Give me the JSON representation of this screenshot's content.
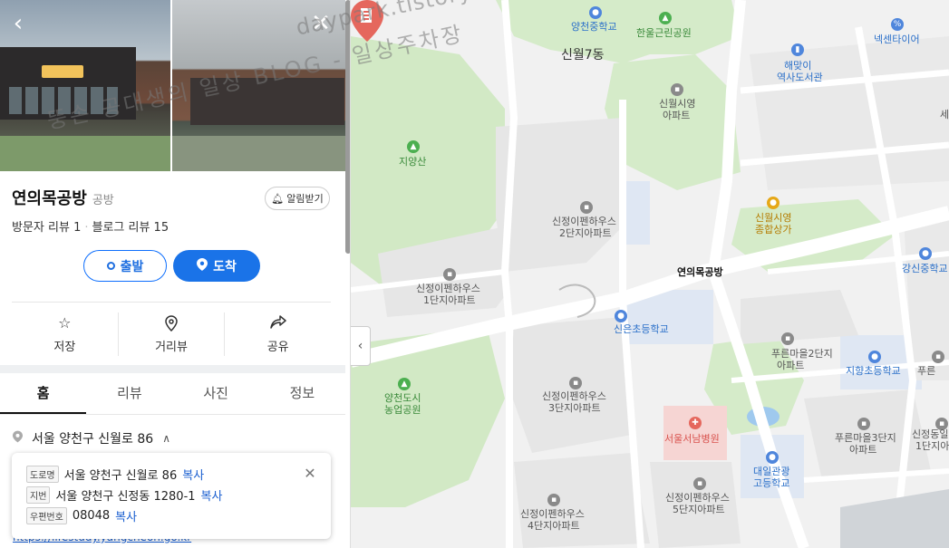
{
  "watermark": {
    "line1": "daypark.tistory.com",
    "line2": "뚱손 공대생의 일상 BLOG - 일상주차장"
  },
  "place": {
    "name": "연의목공방",
    "category": "공방",
    "alarm_label": "알림받기",
    "visitor_reviews": "방문자 리뷰 1",
    "blog_reviews": "블로그 리뷰 15"
  },
  "route": {
    "start_label": "출발",
    "end_label": "도착"
  },
  "actions": [
    {
      "label": "저장",
      "icon": "star-icon"
    },
    {
      "label": "거리뷰",
      "icon": "streetview-icon"
    },
    {
      "label": "공유",
      "icon": "share-icon"
    }
  ],
  "tabs": [
    "홈",
    "리뷰",
    "사진",
    "정보"
  ],
  "address": {
    "summary": "서울 양천구 신월로 86",
    "url": "https://lifestudy.yangcheon.go.kr"
  },
  "address_popup": {
    "road_tag": "도로명",
    "road_value": "서울 양천구 신월로 86",
    "lot_tag": "지번",
    "lot_value": "서울 양천구 신정동 1280-1",
    "zip_tag": "우편번호",
    "zip_value": "08048",
    "copy_label": "복사"
  },
  "map_labels": {
    "yangcheon_ms": "양천중학교",
    "hanul_park": "한울근린공원",
    "nexen": "넥센타이어",
    "sinwol7": "신월7동",
    "haemaji_1": "해맞이",
    "haemaji_2": "역사도서관",
    "sinwol_apt_1": "신월시영",
    "sinwol_apt_2": "아파트",
    "jiyangsan": "지양산",
    "sinwol_mall_1": "신월시영",
    "sinwol_mall_2": "종합상가",
    "jeong2_1": "신정이펜하우스",
    "jeong2_2": "2단지아파트",
    "gangsin_ms": "강신중학교",
    "jeong1_1": "신정이펜하우스",
    "jeong1_2": "1단지아파트",
    "place_pin": "연의목공방",
    "sineun_es": "신은초등학교",
    "pureun2_1": "푸른마을2단지",
    "pureun2_2": "아파트",
    "jihyang_es": "지향초등학교",
    "pureun_right": "푸른",
    "yangcheon_farm_1": "양천도시",
    "yangcheon_farm_2": "농업공원",
    "jeong3_1": "신정이펜하우스",
    "jeong3_2": "3단지아파트",
    "seonam_hosp": "서울서남병원",
    "pureun3_1": "푸른마을3단지",
    "pureun3_2": "아파트",
    "jeong_right_1": "신정동일",
    "jeong_right_2": "1단지아",
    "daeil_hs_1": "대일관광",
    "daeil_hs_2": "고등학교",
    "jeong5_1": "신정이펜하우스",
    "jeong5_2": "5단지아파트",
    "jeong4_1": "신정이펜하우스",
    "jeong4_2": "4단지아파트",
    "edge_se": "세"
  },
  "colors": {
    "accent_blue": "#1a73e8",
    "pin_red": "#e5675d",
    "park_green": "#cfe6c3",
    "road_white": "#ffffff"
  }
}
